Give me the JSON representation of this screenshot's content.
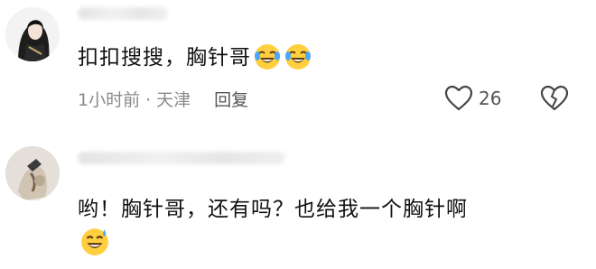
{
  "comments": [
    {
      "text": "扣扣搜搜，胸针哥",
      "emojis": [
        "laugh-cry-emoji",
        "laugh-cry-emoji"
      ],
      "time": "1小时前",
      "separator": "·",
      "location": "天津",
      "reply_label": "回复",
      "like_count": "26"
    },
    {
      "text": "哟！胸针哥，还有吗？也给我一个胸针啊",
      "emojis": [
        "sweat-smile-emoji"
      ]
    }
  ],
  "colors": {
    "text": "#111111",
    "meta": "#8a8a8a",
    "emoji_face": "#ffcf3f"
  }
}
